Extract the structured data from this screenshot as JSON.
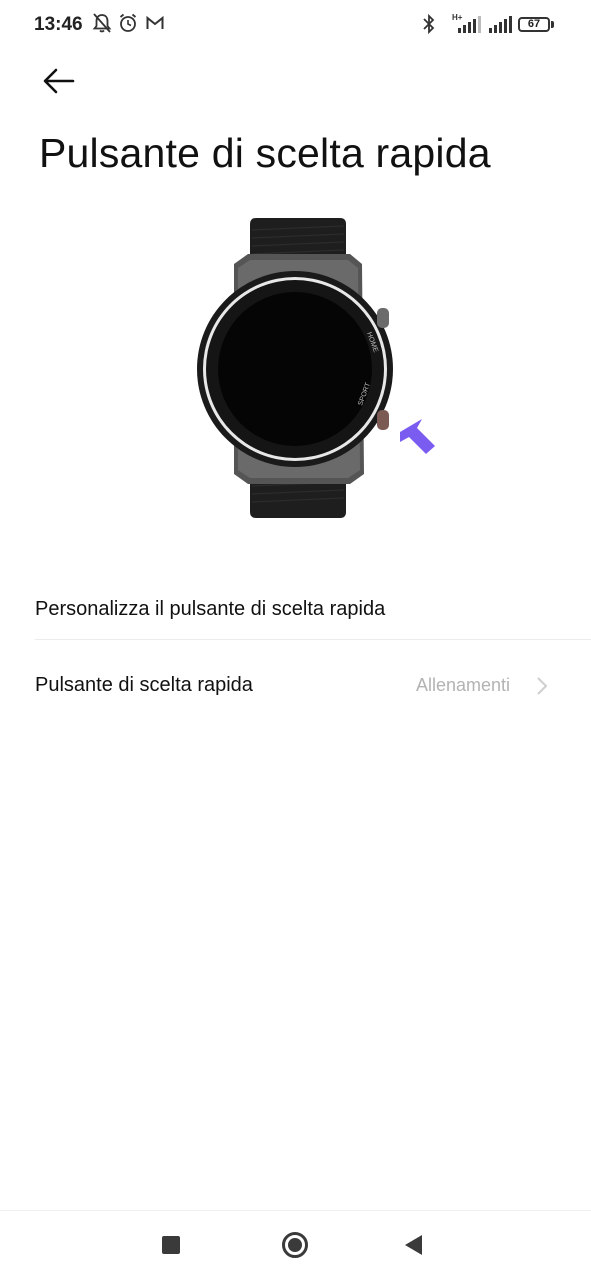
{
  "status_bar": {
    "time": "13:46",
    "network_type": "H+",
    "battery_level": "67",
    "icons": [
      "muted-bell-icon",
      "alarm-icon",
      "gmail-icon",
      "bluetooth-icon",
      "signal-icon",
      "signal-icon",
      "battery-icon"
    ]
  },
  "header": {
    "back_icon": "arrow-left-icon",
    "title": "Pulsante di scelta rapida"
  },
  "illustration": {
    "home_button_text": "HOME",
    "sport_button_text": "SPORT",
    "pointer_color": "#7b5cf0"
  },
  "settings": {
    "section_label": "Personalizza il pulsante di scelta rapida",
    "shortcut_row": {
      "label": "Pulsante di scelta rapida",
      "value": "Allenamenti",
      "icon": "chevron-right-icon"
    }
  },
  "nav_bar": {
    "items": [
      "recents-square-icon",
      "home-circle-icon",
      "back-triangle-icon"
    ]
  }
}
